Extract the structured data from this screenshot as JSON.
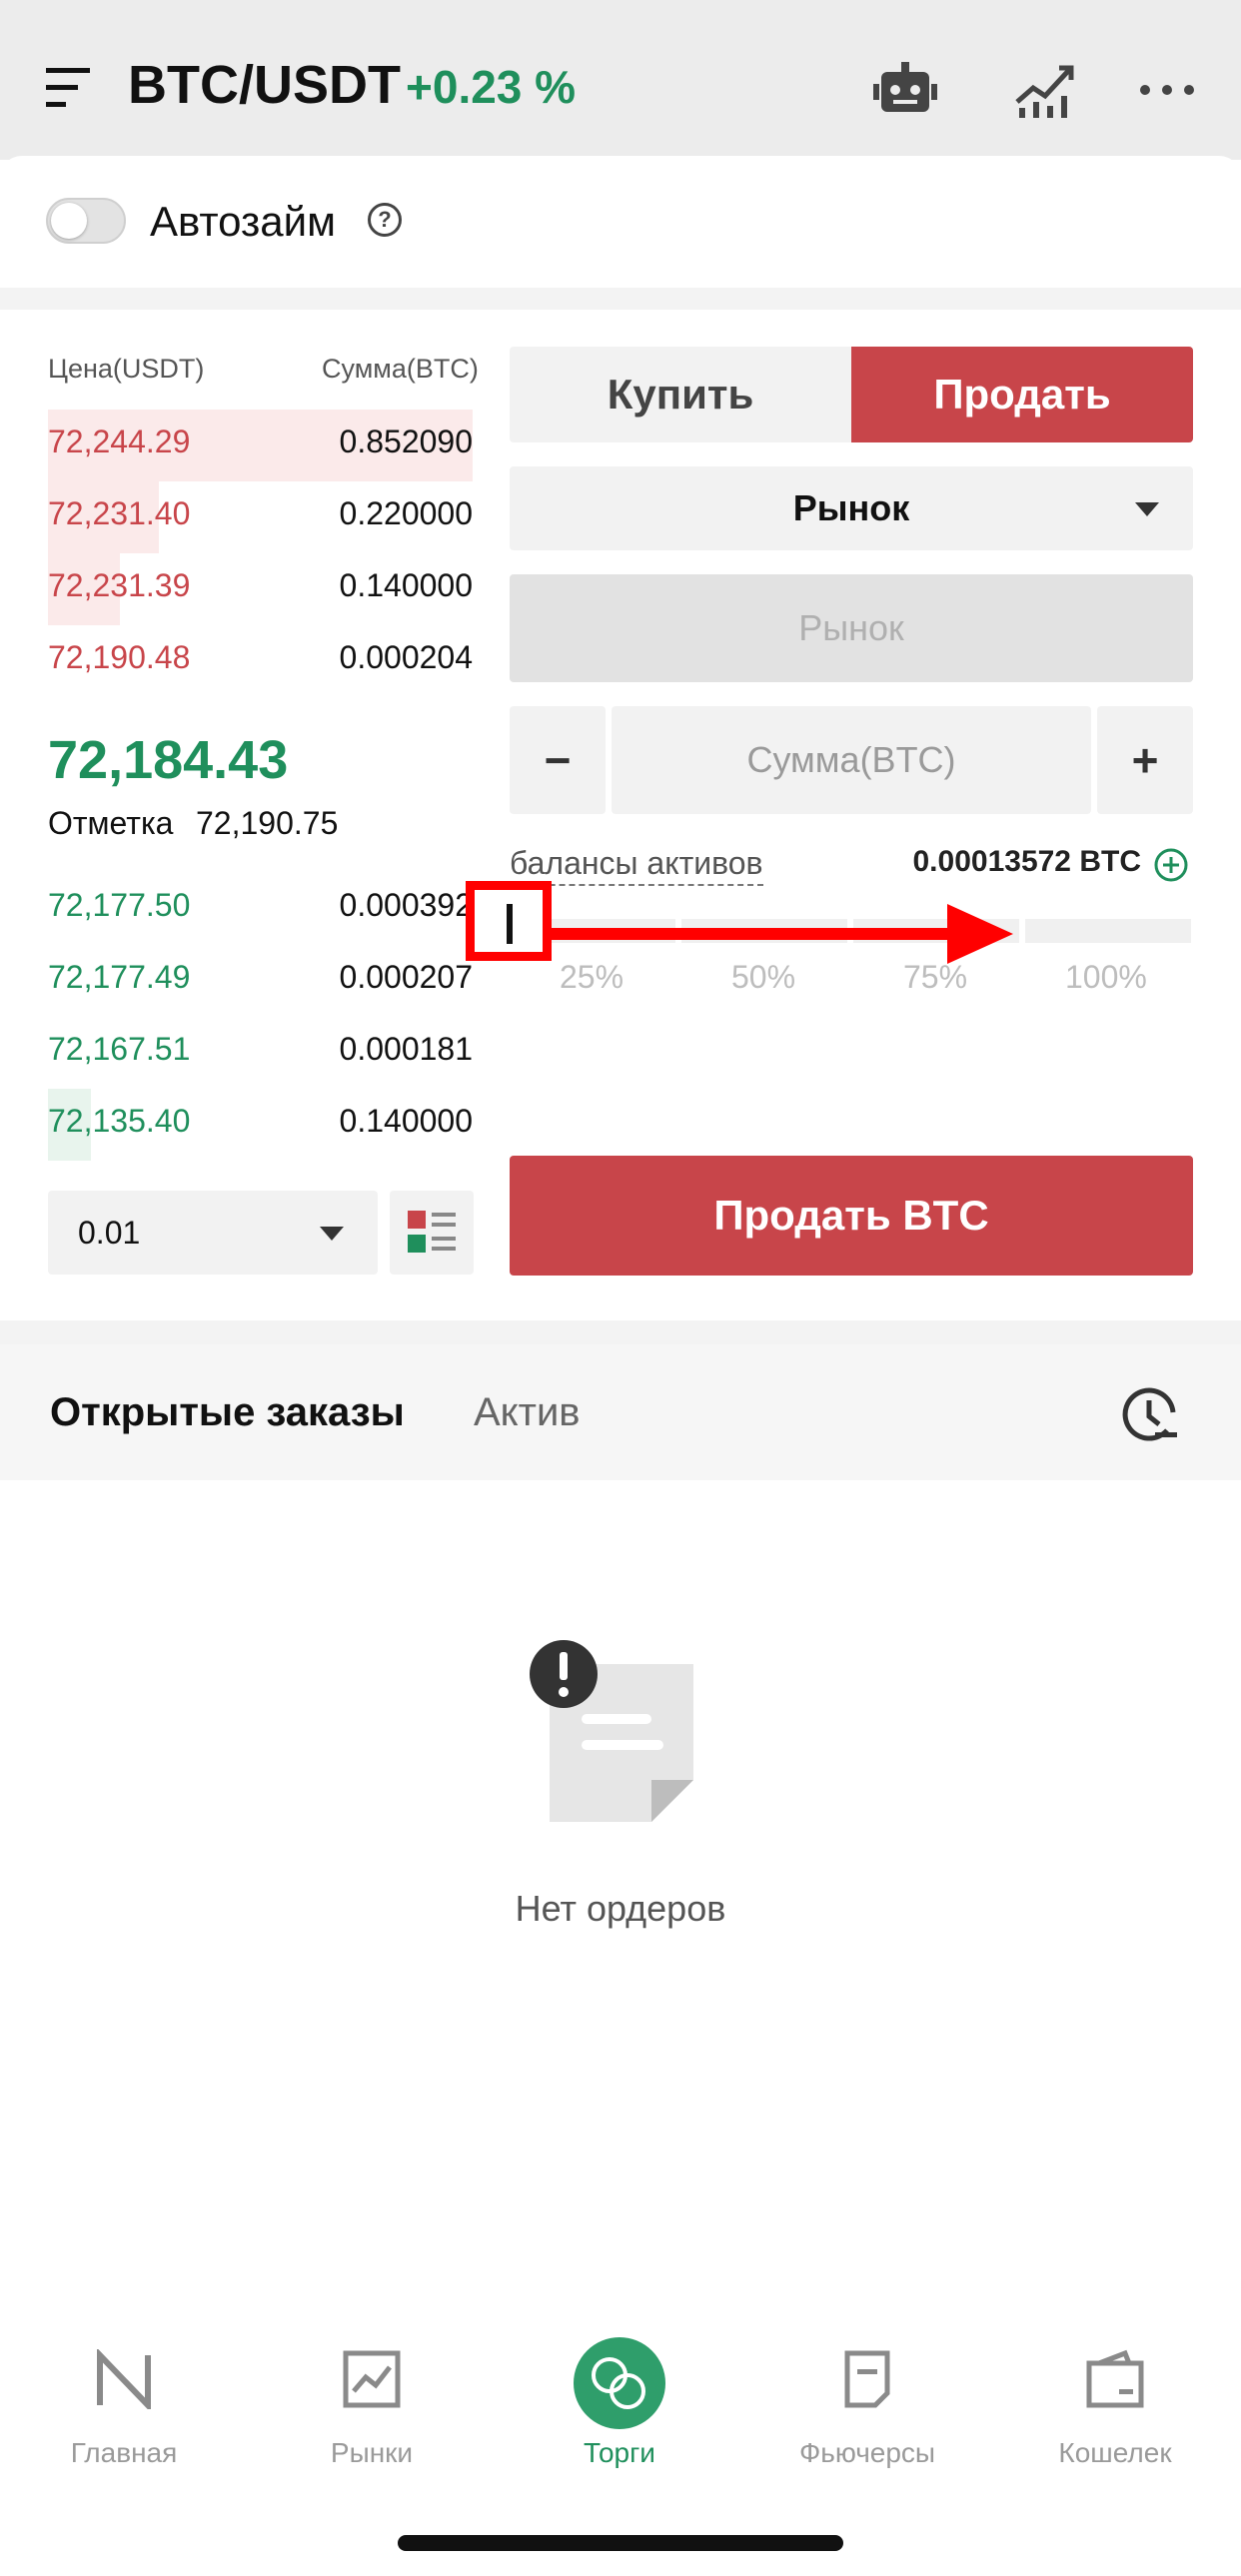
{
  "header": {
    "pair": "BTC/USDT",
    "change": "+0.23 %",
    "icons": [
      "menu-icon",
      "robot-icon",
      "chart-icon",
      "more-icon"
    ]
  },
  "autoloan": {
    "label": "Автозайм",
    "help": "?"
  },
  "orderbook": {
    "col_price": "Цена(USDT)",
    "col_amount": "Сумма(BTC)",
    "asks": [
      {
        "price": "72,244.29",
        "amount": "0.852090",
        "depth": 1.0
      },
      {
        "price": "72,231.40",
        "amount": "0.220000",
        "depth": 0.26
      },
      {
        "price": "72,231.39",
        "amount": "0.140000",
        "depth": 0.17
      },
      {
        "price": "72,190.48",
        "amount": "0.000204",
        "depth": 0.0
      }
    ],
    "last_price": "72,184.43",
    "mark_label": "Отметка",
    "mark_price": "72,190.75",
    "bids": [
      {
        "price": "72,177.50",
        "amount": "0.000392",
        "depth": 0.0
      },
      {
        "price": "72,177.49",
        "amount": "0.000207",
        "depth": 0.0
      },
      {
        "price": "72,167.51",
        "amount": "0.000181",
        "depth": 0.0
      },
      {
        "price": "72,135.40",
        "amount": "0.140000",
        "depth": 0.1
      }
    ],
    "precision": "0.01"
  },
  "trade": {
    "buy_label": "Купить",
    "sell_label": "Продать",
    "order_type": "Рынок",
    "price_placeholder": "Рынок",
    "minus": "−",
    "amount_placeholder": "Сумма(BTC)",
    "plus": "+",
    "balance_label": "балансы активов",
    "balance_value": "0.00013572 BTC",
    "percents": [
      "25%",
      "50%",
      "75%",
      "100%"
    ],
    "slider_value": 0,
    "submit_label": "Продать BTC"
  },
  "orders": {
    "tab_open": "Открытые заказы",
    "tab_asset": "Актив",
    "empty_text": "Нет ордеров"
  },
  "nav": {
    "items": [
      {
        "label": "Главная",
        "icon": "home-icon"
      },
      {
        "label": "Рынки",
        "icon": "markets-icon"
      },
      {
        "label": "Торги",
        "icon": "trade-icon",
        "active": true
      },
      {
        "label": "Фьючерсы",
        "icon": "futures-icon"
      },
      {
        "label": "Кошелек",
        "icon": "wallet-icon"
      }
    ]
  },
  "colors": {
    "red": "#c8454a",
    "green": "#1f8f5c",
    "annotation": "#ff0000"
  }
}
